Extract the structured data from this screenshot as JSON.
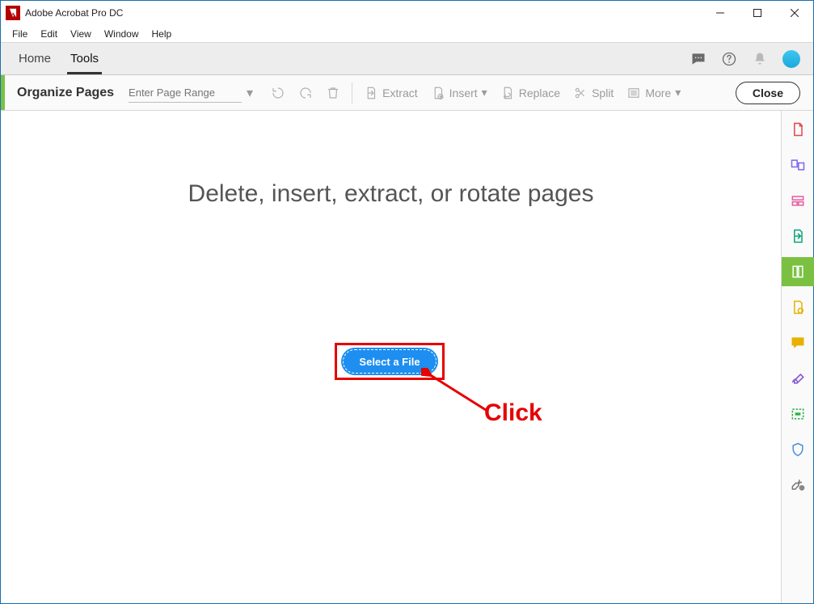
{
  "window": {
    "title": "Adobe Acrobat Pro DC"
  },
  "menubar": {
    "items": [
      "File",
      "Edit",
      "View",
      "Window",
      "Help"
    ]
  },
  "navbar": {
    "home": "Home",
    "tools": "Tools"
  },
  "toolbar": {
    "title": "Organize Pages",
    "page_range_placeholder": "Enter Page Range",
    "extract": "Extract",
    "insert": "Insert",
    "replace": "Replace",
    "split": "Split",
    "more": "More",
    "close": "Close"
  },
  "main": {
    "headline": "Delete, insert, extract, or rotate pages",
    "select_file": "Select a File"
  },
  "annotation": {
    "label": "Click"
  }
}
